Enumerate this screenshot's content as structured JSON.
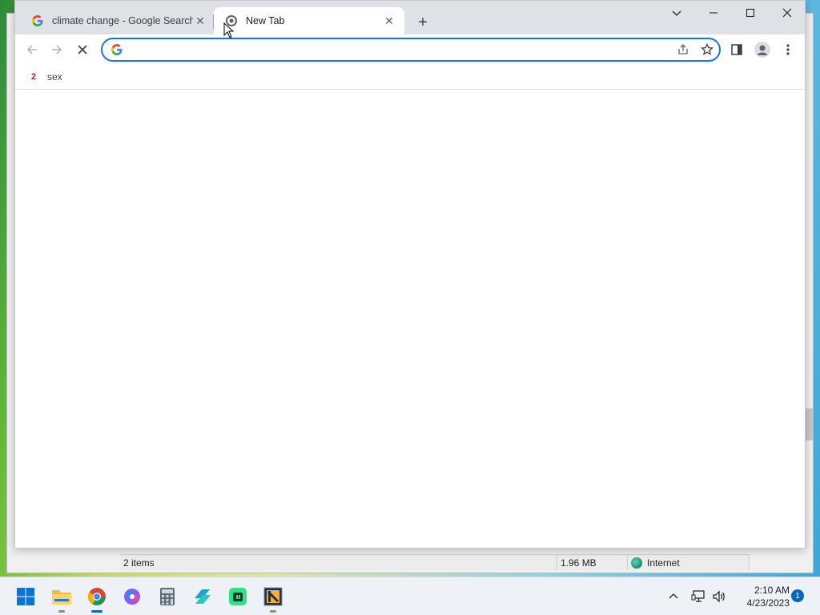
{
  "browser": {
    "tabs": [
      {
        "label": "climate change - Google Search",
        "active": false,
        "icon": "google-g-icon"
      },
      {
        "label": "New Tab",
        "active": true,
        "icon": "loading-icon"
      }
    ],
    "omnibox": {
      "value": "",
      "placeholder": ""
    },
    "bookmarks": [
      {
        "label": "sex",
        "favicon_text": "2"
      }
    ]
  },
  "explorer_status": {
    "items": "2 items",
    "size": "1.96 MB",
    "zone": "Internet"
  },
  "taskbar": {
    "apps": [
      "start-icon",
      "file-explorer-icon",
      "chrome-icon",
      "copilot-icon",
      "calculator-icon",
      "app-icon",
      "app-icon",
      "app-icon"
    ],
    "clock_time": "2:10 AM",
    "clock_date": "4/23/2023",
    "notification_count": "1"
  },
  "colors": {
    "accent": "#1a73e8",
    "tabstrip": "#dee1e6",
    "taskbar": "#eef1f6"
  }
}
